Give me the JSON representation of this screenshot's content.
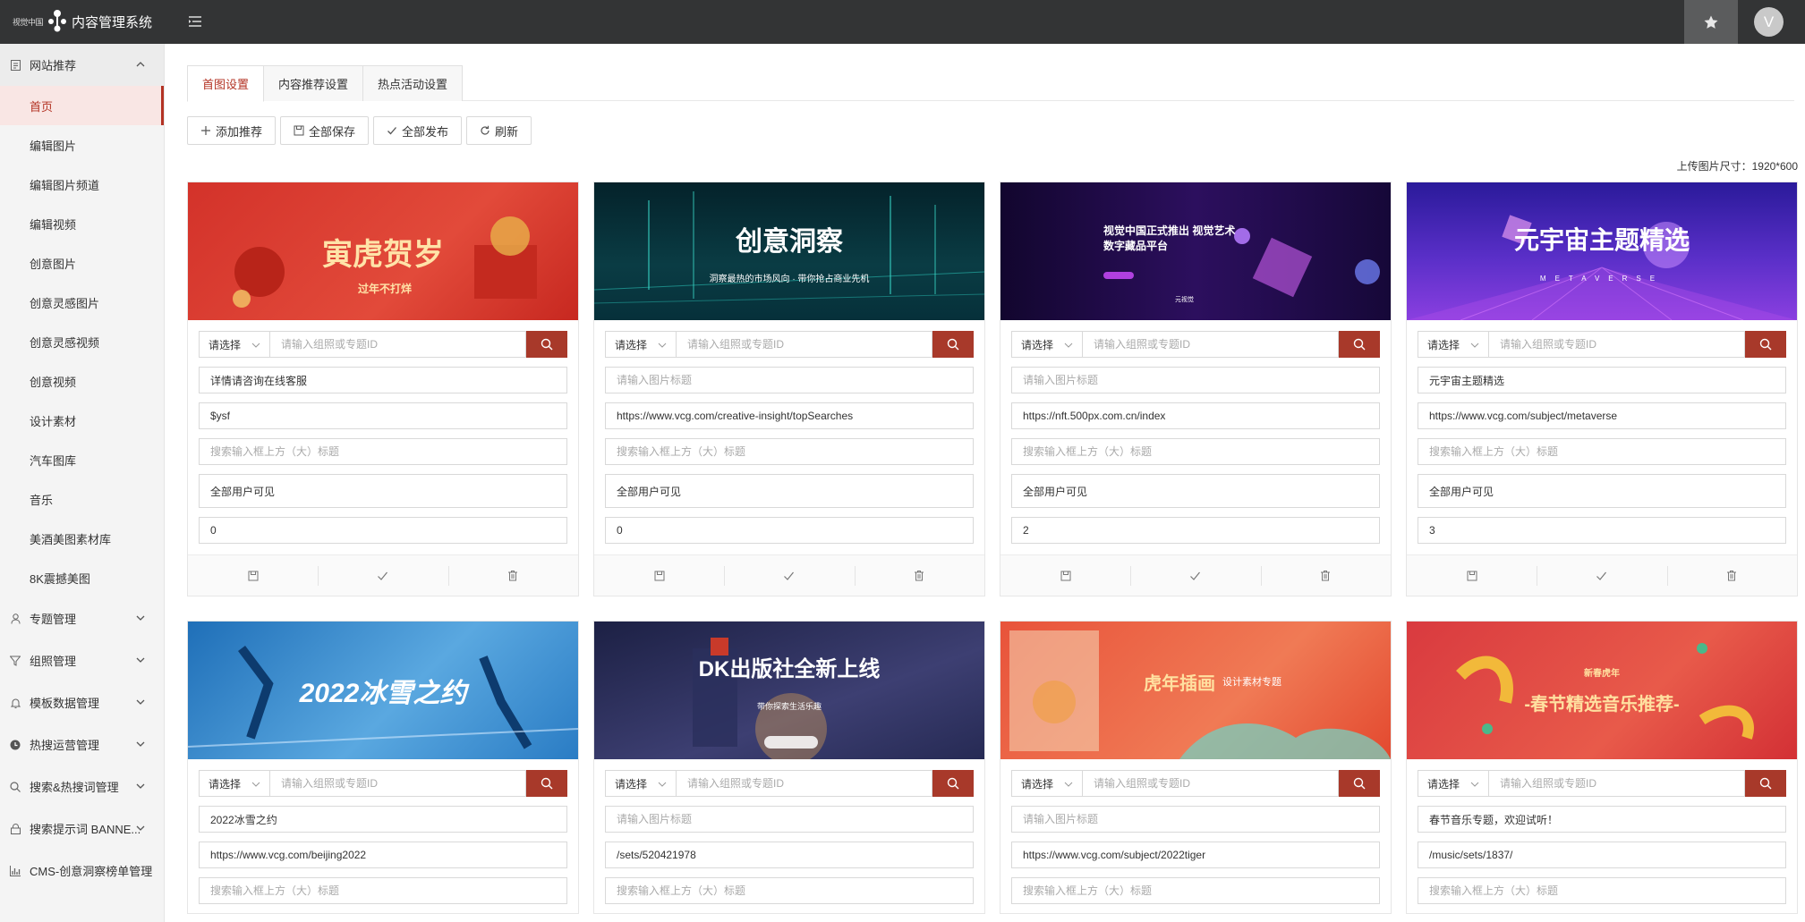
{
  "app": {
    "logo_small": "视觉中国",
    "title": "内容管理系统",
    "avatar_letter": "V"
  },
  "sidebar": {
    "open_group": "网站推荐",
    "items": [
      {
        "label": "首页",
        "active": true
      },
      {
        "label": "编辑图片"
      },
      {
        "label": "编辑图片频道"
      },
      {
        "label": "编辑视频"
      },
      {
        "label": "创意图片"
      },
      {
        "label": "创意灵感图片"
      },
      {
        "label": "创意灵感视频"
      },
      {
        "label": "创意视频"
      },
      {
        "label": "设计素材"
      },
      {
        "label": "汽车图库"
      },
      {
        "label": "音乐"
      },
      {
        "label": "美酒美图素材库"
      },
      {
        "label": "8K震撼美图"
      }
    ],
    "groups": [
      {
        "label": "专题管理",
        "icon": "user-icon"
      },
      {
        "label": "组照管理",
        "icon": "filter-icon"
      },
      {
        "label": "模板数据管理",
        "icon": "bell-icon"
      },
      {
        "label": "热搜运营管理",
        "icon": "clock-icon"
      },
      {
        "label": "搜索&热搜词管理",
        "icon": "search-icon"
      },
      {
        "label": "搜索提示词 BANNE...",
        "icon": "lock-icon"
      },
      {
        "label": "CMS-创意洞察榜单管理",
        "icon": "bar-chart-icon"
      }
    ]
  },
  "tabs": [
    {
      "label": "首图设置",
      "active": true
    },
    {
      "label": "内容推荐设置"
    },
    {
      "label": "热点活动设置"
    }
  ],
  "toolbar": {
    "add": "添加推荐",
    "save_all": "全部保存",
    "publish_all": "全部发布",
    "refresh": "刷新"
  },
  "upload_note": "上传图片尺寸：1920*600",
  "common": {
    "select_label": "请选择",
    "search_placeholder": "请输入组照或专题ID",
    "title_placeholder": "请输入图片标题",
    "subtitle_placeholder": "搜索输入框上方（大）标题"
  },
  "cards": [
    {
      "banner_text": "寅虎贺岁",
      "banner_sub": "过年不打烊",
      "title": "详情请咨询在线客服",
      "link": "$ysf",
      "subtitle": "",
      "visibility": "全部用户可见",
      "order": "0"
    },
    {
      "banner_text": "创意洞察",
      "banner_sub": "洞察最热的市场风向 · 带你抢占商业先机",
      "title": "",
      "link": "https://www.vcg.com/creative-insight/topSearches",
      "subtitle": "",
      "visibility": "全部用户可见",
      "order": "0"
    },
    {
      "banner_text": "视觉中国正式推出 视觉艺术数字藏品平台",
      "banner_sub": "元视觉",
      "title": "",
      "link": "https://nft.500px.com.cn/index",
      "subtitle": "",
      "visibility": "全部用户可见",
      "order": "2"
    },
    {
      "banner_text": "元宇宙主题精选",
      "banner_sub": "METAVERSE",
      "title": "元宇宙主题精选",
      "link": "https://www.vcg.com/subject/metaverse",
      "subtitle": "",
      "visibility": "全部用户可见",
      "order": "3"
    },
    {
      "banner_text": "2022冰雪之约",
      "banner_sub": "",
      "title": "2022冰雪之约",
      "link": "https://www.vcg.com/beijing2022",
      "subtitle": ""
    },
    {
      "banner_text": "DK出版社全新上线",
      "banner_sub": "带你探索生活乐趣",
      "title": "",
      "link": "/sets/520421978",
      "subtitle": ""
    },
    {
      "banner_text": "虎年插画",
      "banner_sub": "设计素材专题",
      "title": "",
      "link": "https://www.vcg.com/subject/2022tiger",
      "subtitle": ""
    },
    {
      "banner_text": "-春节精选音乐推荐-",
      "banner_sub": "新春虎年",
      "title": "春节音乐专题，欢迎试听！",
      "link": "/music/sets/1837/",
      "subtitle": ""
    }
  ]
}
